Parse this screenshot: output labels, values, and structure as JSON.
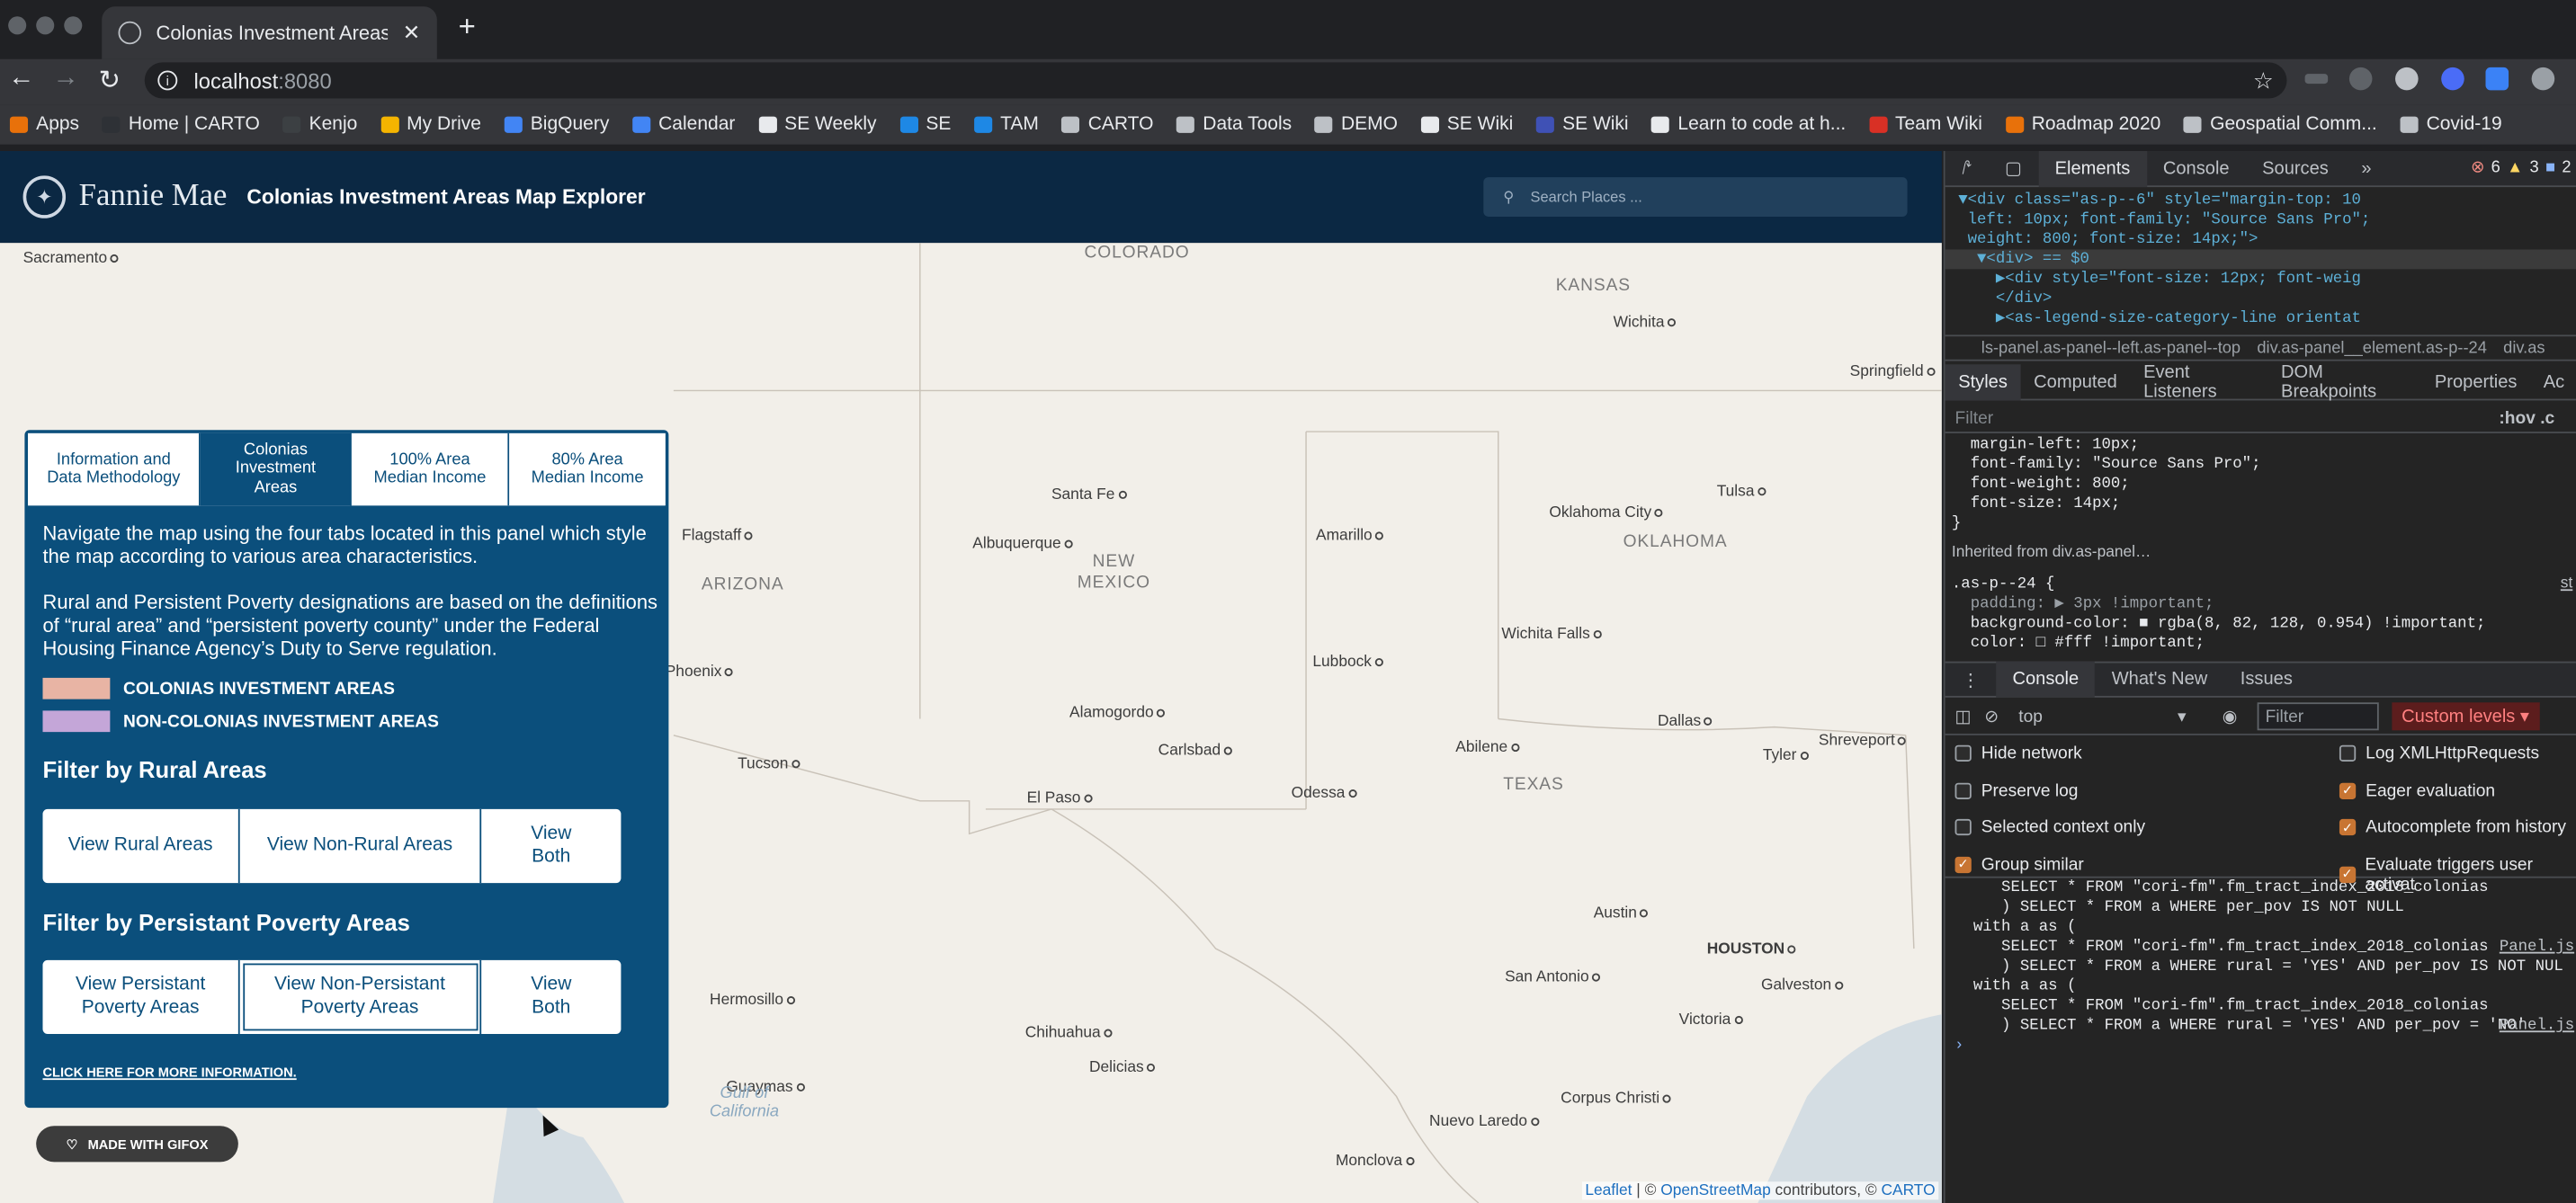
{
  "browser": {
    "tab_title": "Colonias Investment Areas",
    "close_glyph": "✕",
    "new_tab_glyph": "+",
    "url_host": "localhost",
    "url_port": ":8080",
    "bookmarks": [
      {
        "label": "Apps",
        "color": "#e8710a"
      },
      {
        "label": "Home | CARTO",
        "color": "#2e3136"
      },
      {
        "label": "Kenjo",
        "color": "#3c4043"
      },
      {
        "label": "My Drive",
        "color": "#f4b400"
      },
      {
        "label": "BigQuery",
        "color": "#4285f4"
      },
      {
        "label": "Calendar",
        "color": "#4285f4"
      },
      {
        "label": "SE Weekly",
        "color": "#e8eaed"
      },
      {
        "label": "SE",
        "color": "#1e88e5"
      },
      {
        "label": "TAM",
        "color": "#1e88e5"
      },
      {
        "label": "CARTO",
        "color": "#bdc1c6"
      },
      {
        "label": "Data Tools",
        "color": "#bdc1c6"
      },
      {
        "label": "DEMO",
        "color": "#bdc1c6"
      },
      {
        "label": "SE Wiki",
        "color": "#e8eaed"
      },
      {
        "label": "SE Wiki",
        "color": "#3f51b5"
      },
      {
        "label": "Learn to code at h...",
        "color": "#e8eaed"
      },
      {
        "label": "Team Wiki",
        "color": "#d93025"
      },
      {
        "label": "Roadmap 2020",
        "color": "#e8710a"
      },
      {
        "label": "Geospatial Comm...",
        "color": "#bdc1c6"
      },
      {
        "label": "Covid-19",
        "color": "#bdc1c6"
      }
    ]
  },
  "app": {
    "brand": "Fannie Mae",
    "title": "Colonias Investment Areas Map Explorer",
    "search_placeholder": "Search Places ...",
    "tabs": [
      {
        "label": "Information and Data Methodology",
        "active": false
      },
      {
        "label": "Colonias Investment Areas",
        "active": true
      },
      {
        "label": "100% Area Median Income",
        "active": false
      },
      {
        "label": "80% Area Median Income",
        "active": false
      }
    ],
    "intro": "Navigate the map using the four tabs located in this panel which style the map according to various area characteristics.",
    "definitions": "Rural and Persistent Poverty designations are based on the definitions of “rural area” and “persistent poverty county” under the Federal Housing Finance Agency’s Duty to Serve regulation.",
    "legend": [
      {
        "label": "COLONIAS INVESTMENT AREAS",
        "color": "#e8b4a4"
      },
      {
        "label": "NON-COLONIAS INVESTMENT AREAS",
        "color": "#c4a6d8"
      }
    ],
    "rural_heading": "Filter by Rural Areas",
    "rural_buttons": [
      "View Rural Areas",
      "View Non-Rural Areas",
      "View Both"
    ],
    "poverty_heading": "Filter by Persistant Poverty Areas",
    "poverty_buttons": [
      "View Persistant Poverty Areas",
      "View Non-Persistant Poverty Areas",
      "View Both"
    ],
    "more_link": "CLICK HERE FOR MORE INFORMATION.",
    "gifox": "MADE WITH GIFOX",
    "attribution": {
      "leaflet": "Leaflet",
      "sep": " | © ",
      "osm": "OpenStreetMap",
      "mid": " contributors, © ",
      "carto": "CARTO"
    }
  },
  "map": {
    "states": [
      "COLORADO",
      "KANSAS",
      "NEW MEXICO",
      "OKLAHOMA",
      "ARIZONA",
      "TEXAS"
    ],
    "cities": [
      "Sacramento",
      "Wichita",
      "Springfield",
      "Tulsa",
      "Santa Fe",
      "Albuquerque",
      "Amarillo",
      "Oklahoma City",
      "Flagstaff",
      "Phoenix",
      "Wichita Falls",
      "Lubbock",
      "Alamogordo",
      "Dallas",
      "Tyler",
      "Shreveport",
      "Tucson",
      "Carlsbad",
      "Abilene",
      "El Paso",
      "Odessa",
      "Austin",
      "Houston",
      "San Antonio",
      "Galveston",
      "Hermosillo",
      "Chihuahua",
      "Victoria",
      "Delicias",
      "Guaymas",
      "Corpus Christi",
      "Nuevo Laredo",
      "Monclova"
    ],
    "water": "Gulf of California"
  },
  "devtools": {
    "tabs": [
      "Elements",
      "Console",
      "Sources"
    ],
    "badges": {
      "errors": "6",
      "warnings": "3",
      "info": "2"
    },
    "dom_lines": [
      "▼<div class=\"as-p--6\" style=\"margin-top: 10",
      " left: 10px; font-family: \"Source Sans Pro\";",
      " weight: 800; font-size: 14px;\">",
      "  ▼<div> == $0",
      "    ▶<div style=\"font-size: 12px; font-weig",
      "    </div>",
      "    ▶<as-legend-size-category-line orientat"
    ],
    "breadcrumb": [
      "ls-panel.as-panel--left.as-panel--top",
      "div.as-panel__element.as-p--24",
      "div.as"
    ],
    "style_tabs": [
      "Styles",
      "Computed",
      "Event Listeners",
      "DOM Breakpoints",
      "Properties",
      "Ac"
    ],
    "filter": "Filter",
    "hov": ":hov  .c",
    "css_lines": [
      "  margin-left: 10px;",
      "  font-family: \"Source Sans Pro\";",
      "  font-weight: 800;",
      "  font-size: 14px;",
      "}"
    ],
    "inherited": "Inherited from div.as-panel…",
    "rule2": [
      ".as-p--24 {",
      "  padding: ▶ 3px !important;",
      "  background-color: ■ rgba(8, 82, 128, 0.954) !important;",
      "  color: □ #fff !important;"
    ],
    "st_link": "st",
    "console_tabs": [
      "Console",
      "What's New",
      "Issues"
    ],
    "context": "top",
    "console_filter": "Filter",
    "levels": "Custom levels ▾",
    "checks_left": [
      {
        "label": "Hide network",
        "on": false
      },
      {
        "label": "Preserve log",
        "on": false
      },
      {
        "label": "Selected context only",
        "on": false
      },
      {
        "label": "Group similar",
        "on": true
      }
    ],
    "checks_right": [
      {
        "label": "Log XMLHttpRequests",
        "on": false
      },
      {
        "label": "Eager evaluation",
        "on": true
      },
      {
        "label": "Autocomplete from history",
        "on": true
      },
      {
        "label": "Evaluate triggers user activat",
        "on": true
      }
    ],
    "log": [
      "      SELECT * FROM \"cori-fm\".fm_tract_index_2018_colonias",
      "",
      "      ) SELECT * FROM a WHERE per_pov IS NOT NULL",
      "   with a as (",
      "      SELECT * FROM \"cori-fm\".fm_tract_index_2018_colonias",
      "",
      "      ) SELECT * FROM a WHERE rural = 'YES' AND per_pov IS NOT NUL",
      "   with a as (",
      "      SELECT * FROM \"cori-fm\".fm_tract_index_2018_colonias",
      "",
      "      ) SELECT * FROM a WHERE rural = 'YES' AND per_pov = 'NO'",
      "",
      " ›"
    ],
    "source_link": "Panel.js"
  }
}
